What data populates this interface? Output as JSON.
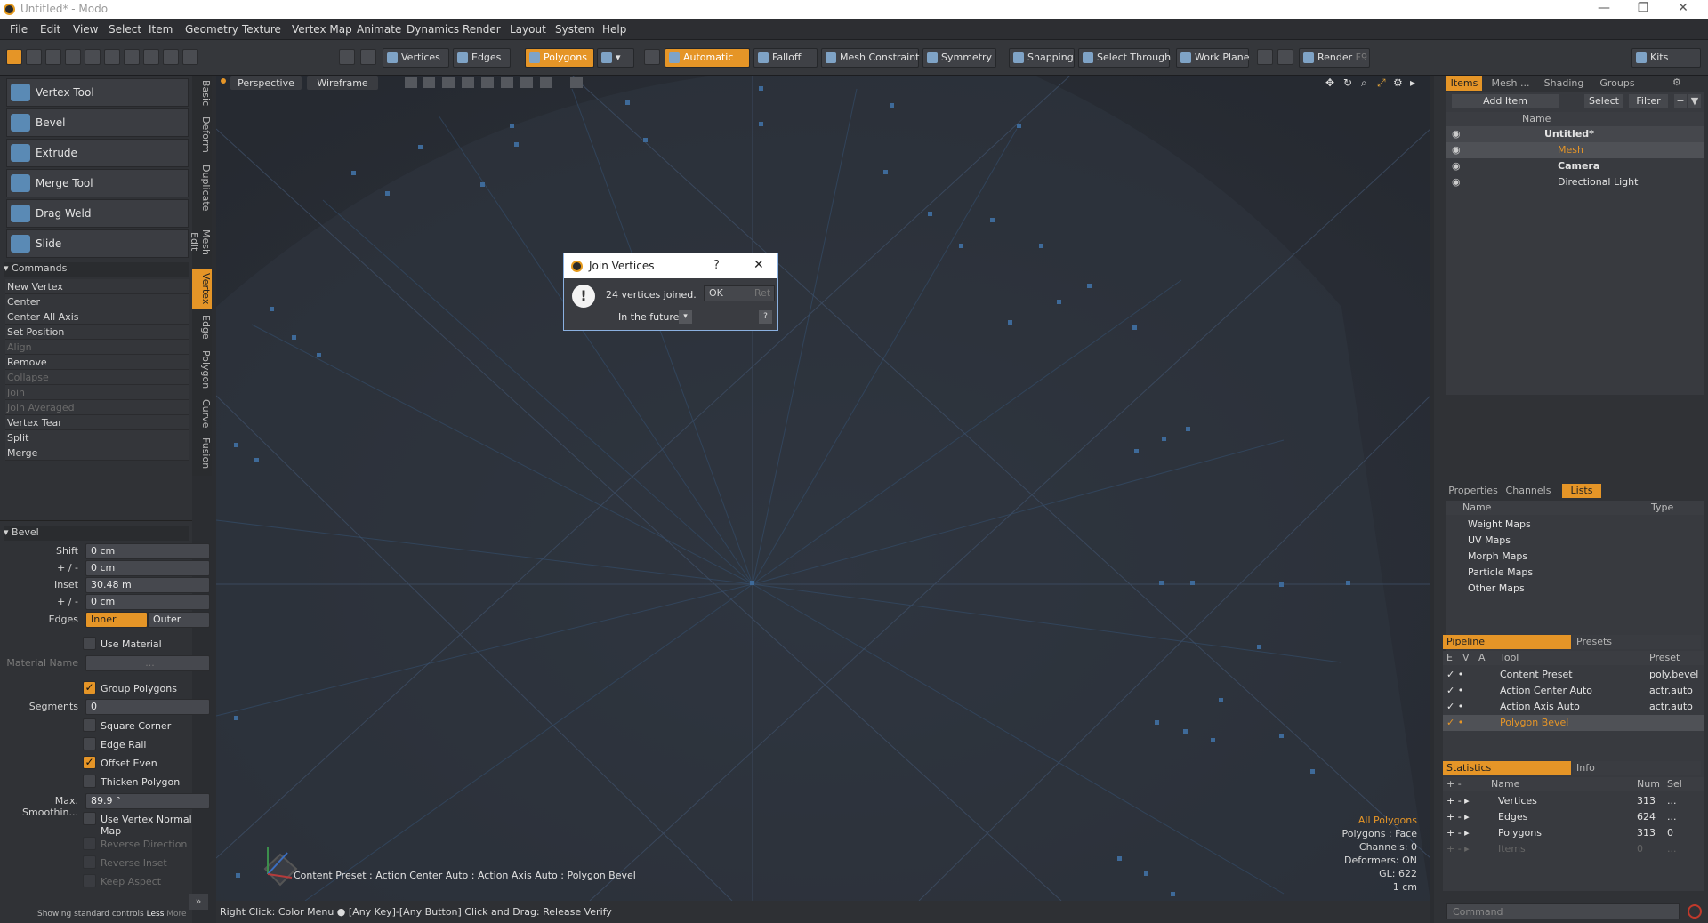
{
  "window": {
    "title": "Untitled* - Modo",
    "minimize": "—",
    "maximize": "❐",
    "close": "✕"
  },
  "menu": [
    "File",
    "Edit",
    "View",
    "Select",
    "Item",
    "Geometry",
    "Texture",
    "Vertex Map",
    "Animate",
    "Dynamics",
    "Render",
    "Layout",
    "System",
    "Help"
  ],
  "toolbar": {
    "vertices": "Vertices",
    "edges": "Edges",
    "polygons": "Polygons",
    "automatic": "Automatic",
    "falloff": "Falloff",
    "mesh_constraint": "Mesh Constraint",
    "symmetry": "Symmetry",
    "snapping": "Snapping",
    "select_through": "Select Through",
    "work_plane": "Work Plane",
    "render": "Render",
    "render_key": "F9",
    "kits": "Kits"
  },
  "left": {
    "tools": [
      "Vertex Tool",
      "Bevel",
      "Extrude",
      "Merge Tool",
      "Drag Weld",
      "Slide"
    ],
    "vtabs": [
      "Basic",
      "Deform",
      "Duplicate",
      "Mesh Edit",
      "Vertex",
      "Edge",
      "Polygon",
      "Curve",
      "Fusion"
    ],
    "commands_header": "Commands",
    "commands": [
      {
        "label": "New Vertex",
        "enabled": true
      },
      {
        "label": "Center",
        "enabled": true
      },
      {
        "label": "Center All Axis",
        "enabled": true
      },
      {
        "label": "Set Position",
        "enabled": true
      },
      {
        "label": "Align",
        "enabled": false
      },
      {
        "label": "Remove",
        "enabled": true
      },
      {
        "label": "Collapse",
        "enabled": false
      },
      {
        "label": "Join",
        "enabled": false
      },
      {
        "label": "Join Averaged",
        "enabled": false
      },
      {
        "label": "Vertex Tear",
        "enabled": true
      },
      {
        "label": "Split",
        "enabled": true
      },
      {
        "label": "Merge",
        "enabled": true
      }
    ],
    "bevel": {
      "header": "Bevel",
      "shift_label": "Shift",
      "shift": "0 cm",
      "pm1_label": "+ / -",
      "pm1": "0 cm",
      "inset_label": "Inset",
      "inset": "30.48 m",
      "pm2_label": "+ / -",
      "pm2": "0 cm",
      "edges_label": "Edges",
      "edges_inner": "Inner",
      "edges_outer": "Outer",
      "use_material": "Use Material",
      "material_name_label": "Material Name",
      "material_name": "...",
      "group_polygons": "Group Polygons",
      "segments_label": "Segments",
      "segments": "0",
      "square_corner": "Square Corner",
      "edge_rail": "Edge Rail",
      "offset_even": "Offset Even",
      "thicken_polygon": "Thicken Polygon",
      "max_smoothing_label": "Max. Smoothin...",
      "max_smoothing": "89.9 °",
      "use_vertex_normal_map": "Use Vertex Normal Map",
      "reverse_direction": "Reverse Direction",
      "reverse_inset": "Reverse Inset",
      "keep_aspect": "Keep Aspect"
    },
    "footer": "Showing standard controls",
    "footer_less": "Less",
    "footer_more": "More"
  },
  "viewport": {
    "view": "Perspective",
    "shading": "Wireframe",
    "preset_line": "Content Preset : Action Center Auto : Action Axis Auto : Polygon Bevel",
    "info": [
      "All Polygons",
      "Polygons : Face",
      "Channels: 0",
      "Deformers: ON",
      "GL: 622",
      "1 cm"
    ]
  },
  "status": {
    "text": "Right Click: Color Menu ● [Any Key]-[Any Button] Click and Drag: Release Verify"
  },
  "dialog": {
    "title": "Join Vertices",
    "help": "?",
    "message": "24 vertices joined.",
    "ok": "OK",
    "reset": "Ret",
    "future": "In the future"
  },
  "right": {
    "tabs": [
      "Items",
      "Mesh ...",
      "Shading",
      "Groups"
    ],
    "add_item": "Add Item",
    "select": "Select",
    "filter": "Filter",
    "name_col": "Name",
    "items": [
      "Untitled*",
      "Mesh",
      "Camera",
      "Directional Light"
    ],
    "mid_tabs": [
      "Properties",
      "Channels",
      "Lists"
    ],
    "lists_name_col": "Name",
    "lists_type_col": "Type",
    "lists": [
      "Weight Maps",
      "UV Maps",
      "Morph Maps",
      "Particle Maps",
      "Other Maps"
    ],
    "pipeline_tab": "Pipeline",
    "presets_tab": "Presets",
    "pipe_cols": [
      "E",
      "V",
      "A",
      "Tool",
      "Preset"
    ],
    "pipeline": [
      {
        "tool": "Content Preset",
        "preset": "poly.bevel"
      },
      {
        "tool": "Action Center Auto",
        "preset": "actr.auto"
      },
      {
        "tool": "Action Axis Auto",
        "preset": "actr.auto"
      },
      {
        "tool": "Polygon Bevel",
        "preset": ""
      }
    ],
    "stats_tab": "Statistics",
    "info_tab": "Info",
    "stat_cols": [
      "Name",
      "Num",
      "Sel"
    ],
    "stats": [
      {
        "name": "Vertices",
        "num": "313",
        "sel": "..."
      },
      {
        "name": "Edges",
        "num": "624",
        "sel": "..."
      },
      {
        "name": "Polygons",
        "num": "313",
        "sel": "0"
      },
      {
        "name": "Items",
        "num": "0",
        "sel": "..."
      }
    ],
    "command_placeholder": "Command"
  },
  "colors": {
    "accent": "#e59527",
    "viewport_bg": "#2a2e36",
    "wire": "#3d5f86"
  }
}
